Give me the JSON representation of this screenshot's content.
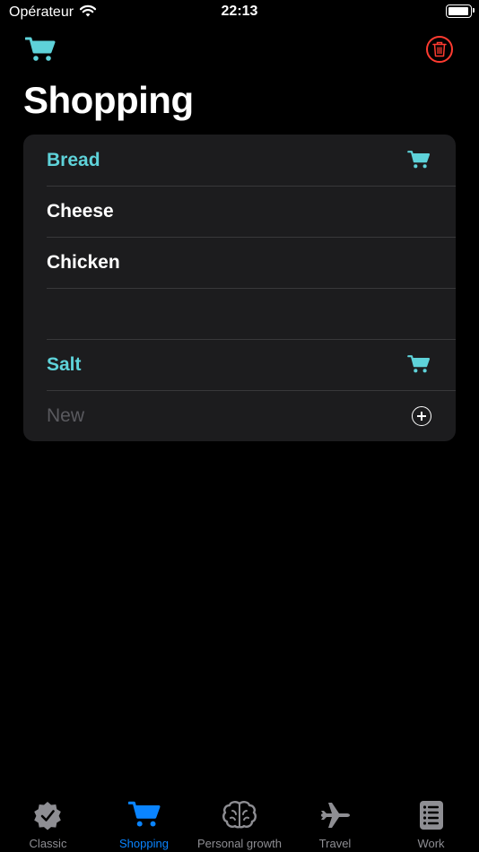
{
  "status": {
    "carrier": "Opérateur",
    "time": "22:13",
    "battery_level": 0.95
  },
  "header": {
    "title": "Shopping",
    "left_icon": "cart-icon",
    "right_icon": "trash-icon",
    "accent_color": "#5ed2d9",
    "destructive_color": "#ff3b30"
  },
  "list": {
    "items": [
      {
        "label": "Bread",
        "highlighted": true,
        "icon": "cart-icon"
      },
      {
        "label": "Cheese",
        "highlighted": false
      },
      {
        "label": "Chicken",
        "highlighted": false
      },
      {
        "label": "",
        "highlighted": false
      },
      {
        "label": "Salt",
        "highlighted": true,
        "icon": "cart-icon"
      }
    ],
    "new_placeholder": "New",
    "add_icon": "plus-circle-icon"
  },
  "tabs": [
    {
      "label": "Classic",
      "icon": "checkmark-seal-icon",
      "active": false
    },
    {
      "label": "Shopping",
      "icon": "cart-icon",
      "active": true
    },
    {
      "label": "Personal growth",
      "icon": "brain-icon",
      "active": false
    },
    {
      "label": "Travel",
      "icon": "airplane-icon",
      "active": false
    },
    {
      "label": "Work",
      "icon": "document-icon",
      "active": false
    }
  ],
  "tab_active_color": "#0a84ff",
  "tab_inactive_color": "#8e8e93"
}
